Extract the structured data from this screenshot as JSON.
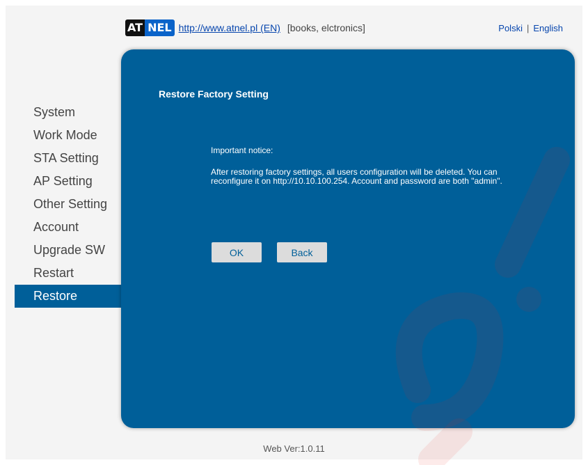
{
  "header": {
    "logo": {
      "part1": "AT",
      "part2": "NEL"
    },
    "link_text": "http://www.atnel.pl (EN)",
    "tagline": "[books, elctronics]"
  },
  "lang": {
    "polski": "Polski",
    "separator": "|",
    "english": "English"
  },
  "sidebar": {
    "items": [
      {
        "label": "System"
      },
      {
        "label": "Work Mode"
      },
      {
        "label": "STA Setting"
      },
      {
        "label": "AP Setting"
      },
      {
        "label": "Other Setting"
      },
      {
        "label": "Account"
      },
      {
        "label": "Upgrade SW"
      },
      {
        "label": "Restart"
      },
      {
        "label": "Restore",
        "active": true
      }
    ]
  },
  "panel": {
    "title": "Restore Factory Setting",
    "notice_title": "Important notice:",
    "notice_body": "After restoring factory settings, all users configuration will be deleted. You can reconfigure it on http://10.10.100.254. Account and password are both \"admin\".",
    "ok_label": "OK",
    "back_label": "Back"
  },
  "footer": {
    "version": "Web Ver:1.0.11"
  },
  "colors": {
    "panel": "#005f99",
    "active_item": "#005f99",
    "watermark": "#e8201a"
  }
}
